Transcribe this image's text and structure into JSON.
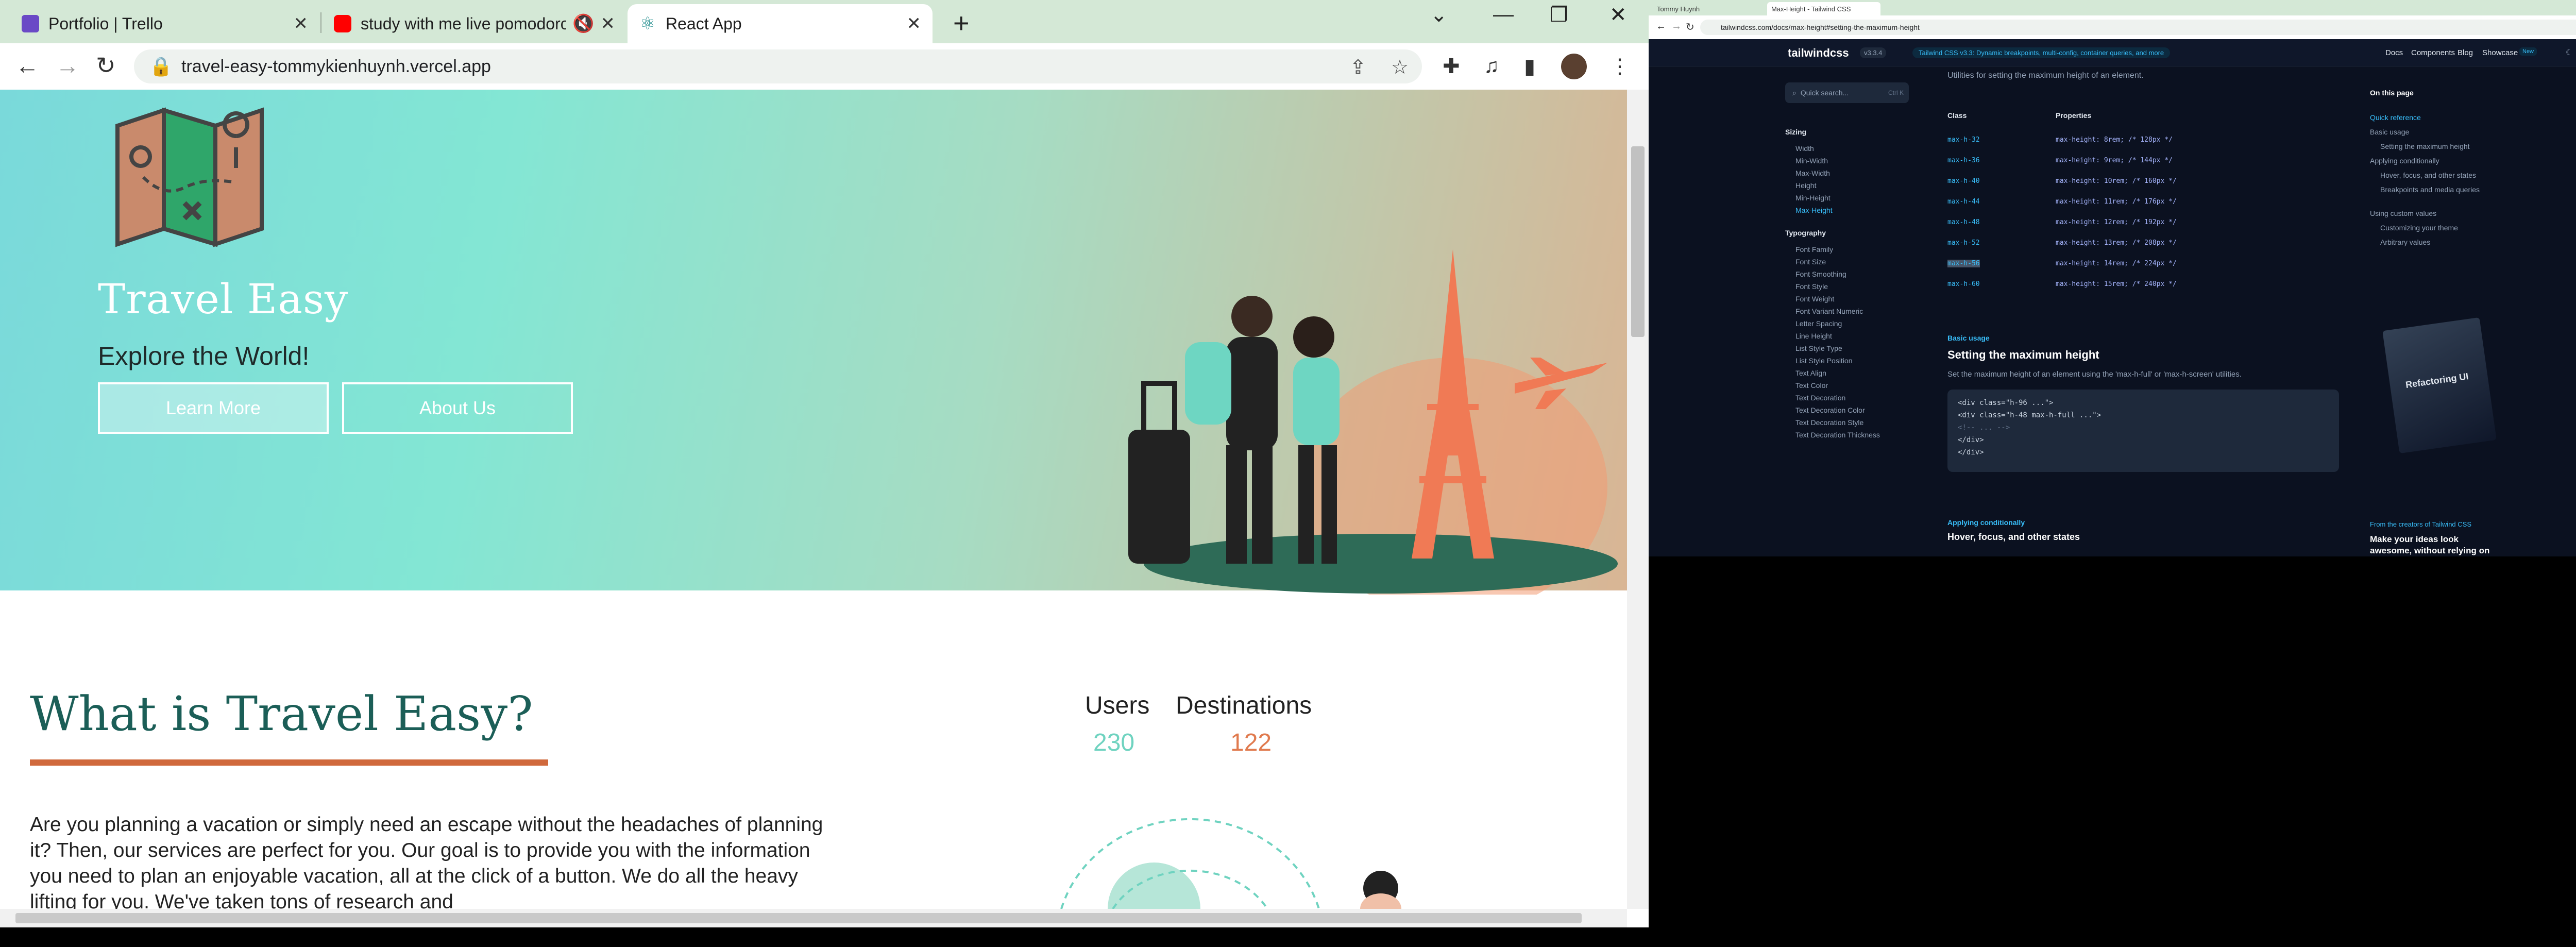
{
  "left_browser": {
    "tabs": [
      {
        "title": "Portfolio | Trello",
        "favicon": "trello-icon",
        "color": "#6a49c6"
      },
      {
        "title": "study with me live pomodoro",
        "favicon": "youtube-icon",
        "color": "#ff0000"
      },
      {
        "title": "React App",
        "favicon": "react-icon",
        "color": "#1b8a8a"
      }
    ],
    "new_tab": "+",
    "address": "travel-easy-tommykienhuynh.vercel.app",
    "page": {
      "hero_title": "Travel Easy",
      "hero_subtitle": "Explore the World!",
      "learn_more": "Learn More",
      "about_us": "About Us",
      "section_title": "What is Travel Easy?",
      "stats": [
        {
          "label": "Users",
          "value": "230",
          "color": "#6fd3c0"
        },
        {
          "label": "Destinations",
          "value": "122",
          "color": "#e07a4e"
        }
      ],
      "body_text": "Are you planning a vacation or simply need an escape without the headaches of planning it? Then, our services are perfect for you. Our goal is to provide you with the information you need to plan an enjoyable vacation, all at the click of a button. We do all the heavy lifting for you. We've taken tons of research and"
    }
  },
  "right_browser": {
    "tabs": [
      {
        "title": "Tommy Huynh"
      },
      {
        "title": "Max-Height - Tailwind CSS"
      }
    ],
    "address": "tailwindcss.com/docs/max-height#setting-the-maximum-height",
    "brand": "tailwindcss",
    "version": "v3.3.4",
    "announcement": "Tailwind CSS v3.3: Dynamic breakpoints, multi-config, container queries, and more",
    "nav": [
      "Docs",
      "Components",
      "Blog",
      "Showcase"
    ],
    "new_badge": "New",
    "search_placeholder": "Quick search...",
    "search_shortcut": "Ctrl K",
    "sidebar_sections": [
      {
        "title": "Sizing",
        "items": [
          "Width",
          "Min-Width",
          "Max-Width",
          "Height",
          "Min-Height",
          "Max-Height"
        ]
      },
      {
        "title": "Typography",
        "items": [
          "Font Family",
          "Font Size",
          "Font Smoothing",
          "Font Style",
          "Font Weight",
          "Font Variant Numeric",
          "Letter Spacing",
          "Line Height",
          "List Style Type",
          "List Style Position",
          "Text Align",
          "Text Color",
          "Text Decoration",
          "Text Decoration Color",
          "Text Decoration Style",
          "Text Decoration Thickness"
        ]
      }
    ],
    "intro": "Utilities for setting the maximum height of an element.",
    "table_headers": [
      "Class",
      "Properties"
    ],
    "table_rows": [
      {
        "cls": "max-h-32",
        "prop": "max-height: 8rem; /* 128px */"
      },
      {
        "cls": "max-h-36",
        "prop": "max-height: 9rem; /* 144px */"
      },
      {
        "cls": "max-h-40",
        "prop": "max-height: 10rem; /* 160px */"
      },
      {
        "cls": "max-h-44",
        "prop": "max-height: 11rem; /* 176px */"
      },
      {
        "cls": "max-h-48",
        "prop": "max-height: 12rem; /* 192px */"
      },
      {
        "cls": "max-h-52",
        "prop": "max-height: 13rem; /* 208px */"
      },
      {
        "cls": "max-h-56",
        "prop": "max-height: 14rem; /* 224px */"
      },
      {
        "cls": "max-h-60",
        "prop": "max-height: 15rem; /* 240px */"
      }
    ],
    "basic_usage": "Basic usage",
    "heading": "Setting the maximum height",
    "description": "Set the maximum height of an element using the 'max-h-full' or 'max-h-screen' utilities.",
    "code": [
      "<div class=\"h-96 ...\">",
      "  <div class=\"h-48 max-h-full ...\">",
      "    <!-- ... -->",
      "  </div>",
      "</div>"
    ],
    "applying_small": "Applying conditionally",
    "applying_heading": "Hover, focus, and other states",
    "toc_title": "On this page",
    "toc": [
      "Quick reference",
      "Basic usage",
      "Setting the maximum height",
      "Applying conditionally",
      "Hover, focus, and other states",
      "Breakpoints and media queries",
      "Using custom values",
      "Customizing your theme",
      "Arbitrary values"
    ],
    "book_title": "Refactoring UI",
    "ad_small": "From the creators of Tailwind CSS",
    "ad_heading": "Make your ideas look awesome, without relying on a designer."
  }
}
